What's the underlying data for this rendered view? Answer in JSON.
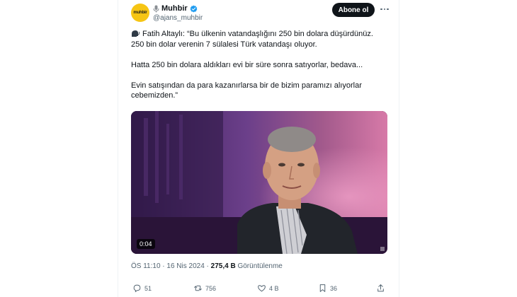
{
  "tweet": {
    "avatar_text": "muhbir",
    "display_name": "Muhbir",
    "handle": "@ajans_muhbir",
    "follow_label": "Abone ol",
    "text_lines": [
      "Fatih Altaylı: “Bu ülkenin vatandaşlığını 250 bin dolara düşürdünüz.",
      "250 bin dolar verenin 7 sülalesi Türk vatandaşı oluyor.",
      "Hatta 250 bin dolara aldıkları evi bir süre sonra satıyorlar, bedava...",
      "Evin satışından da para kazanırlarsa bir de bizim paramızı alıyorlar",
      "cebemizden.”"
    ],
    "video_duration": "0:04",
    "time": "ÖS 11:10 · 16 Nis 2024 · ",
    "views_count": "275,4 B",
    "views_label": " Görüntülenme",
    "actions": {
      "replies": "51",
      "reposts": "756",
      "likes": "4 B",
      "bookmarks": "36"
    }
  },
  "colors": {
    "avatar_bg": "#f6c514",
    "verified": "#1d9bf0",
    "text": "#0f1419",
    "muted": "#536471"
  }
}
